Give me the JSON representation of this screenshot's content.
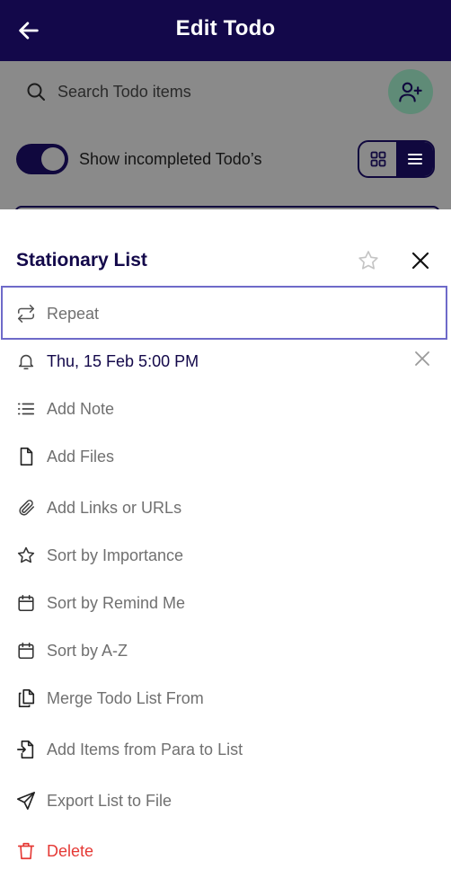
{
  "appbar": {
    "title": "Edit Todo",
    "back_icon": "arrow-left-icon",
    "bg": "#13084a"
  },
  "search": {
    "placeholder": "Search Todo items"
  },
  "toggle": {
    "label": "Show incompleted Todo’s",
    "on": true
  },
  "sheet": {
    "title": "Stationary List",
    "items": [
      {
        "label": "Repeat",
        "icon": "repeat-icon"
      },
      {
        "label": "Thu, 15 Feb 5:00 PM",
        "icon": "bell-icon"
      },
      {
        "label": "Add Note",
        "icon": "list-icon"
      },
      {
        "label": "Add Files",
        "icon": "file-icon"
      },
      {
        "label": "Add Links or URLs",
        "icon": "paperclip-icon"
      },
      {
        "label": "Sort by Importance",
        "icon": "star-icon"
      },
      {
        "label": "Sort by Remind Me",
        "icon": "calendar-icon"
      },
      {
        "label": "Sort by A-Z",
        "icon": "calendar-icon"
      },
      {
        "label": "Merge Todo List From",
        "icon": "copy-icon"
      },
      {
        "label": "Add Items from Para to List",
        "icon": "file-import-icon"
      },
      {
        "label": "Export List to File",
        "icon": "send-icon"
      },
      {
        "label": "Delete",
        "icon": "trash-icon"
      }
    ]
  },
  "colors": {
    "primary": "#13084a",
    "danger": "#e53935",
    "accent_green": "#5f8b77",
    "focus_border": "#6e6ac9"
  }
}
